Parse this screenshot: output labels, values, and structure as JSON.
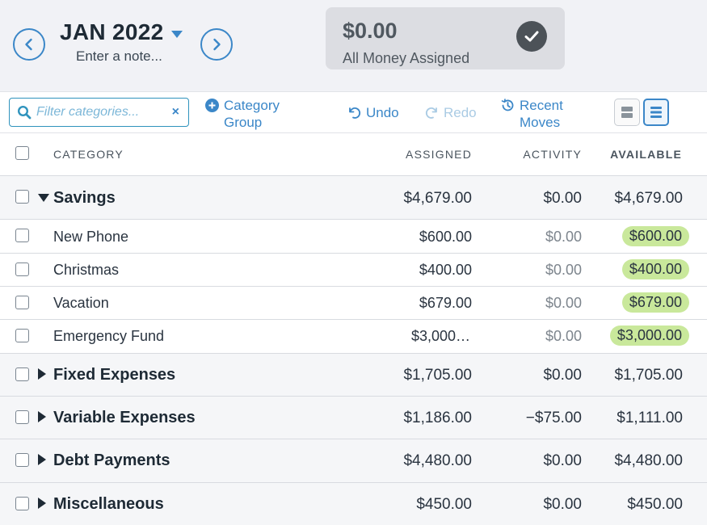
{
  "header": {
    "month": "JAN 2022",
    "note_placeholder": "Enter a note...",
    "to_be_assigned": {
      "amount": "$0.00",
      "label": "All Money Assigned"
    }
  },
  "toolbar": {
    "filter_placeholder": "Filter categories...",
    "filter_clear": "×",
    "category_group_line1": "Category",
    "category_group_line2": "Group",
    "undo": "Undo",
    "redo": "Redo",
    "recent_moves_line1": "Recent",
    "recent_moves_line2": "Moves"
  },
  "columns": {
    "category": "CATEGORY",
    "assigned": "ASSIGNED",
    "activity": "ACTIVITY",
    "available": "AVAILABLE"
  },
  "groups": [
    {
      "name": "Savings",
      "expanded": true,
      "assigned": "$4,679.00",
      "activity": "$0.00",
      "available": "$4,679.00",
      "items": [
        {
          "name": "New Phone",
          "assigned": "$600.00",
          "activity": "$0.00",
          "available": "$600.00"
        },
        {
          "name": "Christmas",
          "assigned": "$400.00",
          "activity": "$0.00",
          "available": "$400.00"
        },
        {
          "name": "Vacation",
          "assigned": "$679.00",
          "activity": "$0.00",
          "available": "$679.00"
        },
        {
          "name": "Emergency Fund",
          "assigned": "$3,000…",
          "activity": "$0.00",
          "available": "$3,000.00"
        }
      ]
    },
    {
      "name": "Fixed Expenses",
      "expanded": false,
      "assigned": "$1,705.00",
      "activity": "$0.00",
      "available": "$1,705.00"
    },
    {
      "name": "Variable Expenses",
      "expanded": false,
      "assigned": "$1,186.00",
      "activity": "−$75.00",
      "available": "$1,111.00"
    },
    {
      "name": "Debt Payments",
      "expanded": false,
      "assigned": "$4,480.00",
      "activity": "$0.00",
      "available": "$4,480.00"
    },
    {
      "name": "Miscellaneous",
      "expanded": false,
      "assigned": "$450.00",
      "activity": "$0.00",
      "available": "$450.00"
    }
  ],
  "colors": {
    "accent": "#3b87c8",
    "available_positive": "#c9e89b",
    "header_bg": "#f1f2f6",
    "card_bg": "#dcdde2"
  },
  "icons": {
    "prev": "chevron-left-icon",
    "next": "chevron-right-icon",
    "month_menu": "caret-down-icon",
    "assigned_status": "check-circle-icon",
    "search": "search-icon",
    "add": "plus-circle-icon",
    "undo": "undo-icon",
    "redo": "redo-icon",
    "recent": "history-icon"
  }
}
